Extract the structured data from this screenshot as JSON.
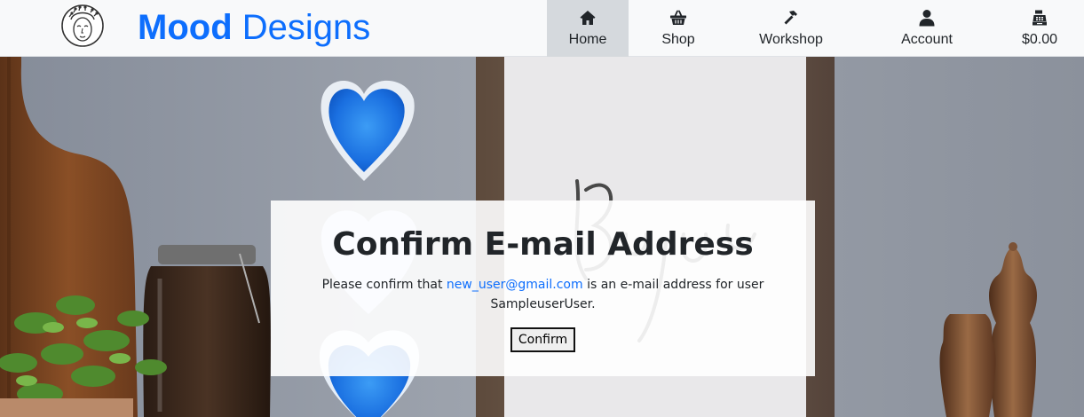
{
  "brand": {
    "strong": "Mood",
    "rest": " Designs"
  },
  "nav": {
    "items": [
      {
        "label": "Home",
        "icon": "home-icon",
        "active": true
      },
      {
        "label": "Shop",
        "icon": "basket-icon",
        "active": false
      },
      {
        "label": "Workshop",
        "icon": "hammer-icon",
        "active": false
      },
      {
        "label": "Account",
        "icon": "user-icon",
        "active": false
      },
      {
        "label": "$0.00",
        "icon": "cash-register-icon",
        "active": false
      }
    ]
  },
  "confirm": {
    "title": "Confirm E-mail Address",
    "text_before": "Please confirm that ",
    "email": "new_user@gmail.com",
    "text_after": " is an e-mail address for user SampleuserUser.",
    "button": "Confirm"
  },
  "colors": {
    "brand": "#0d6efd",
    "nav_bg": "#f8f9fa",
    "nav_active": "#d5d9dd",
    "link": "#0d6efd"
  }
}
